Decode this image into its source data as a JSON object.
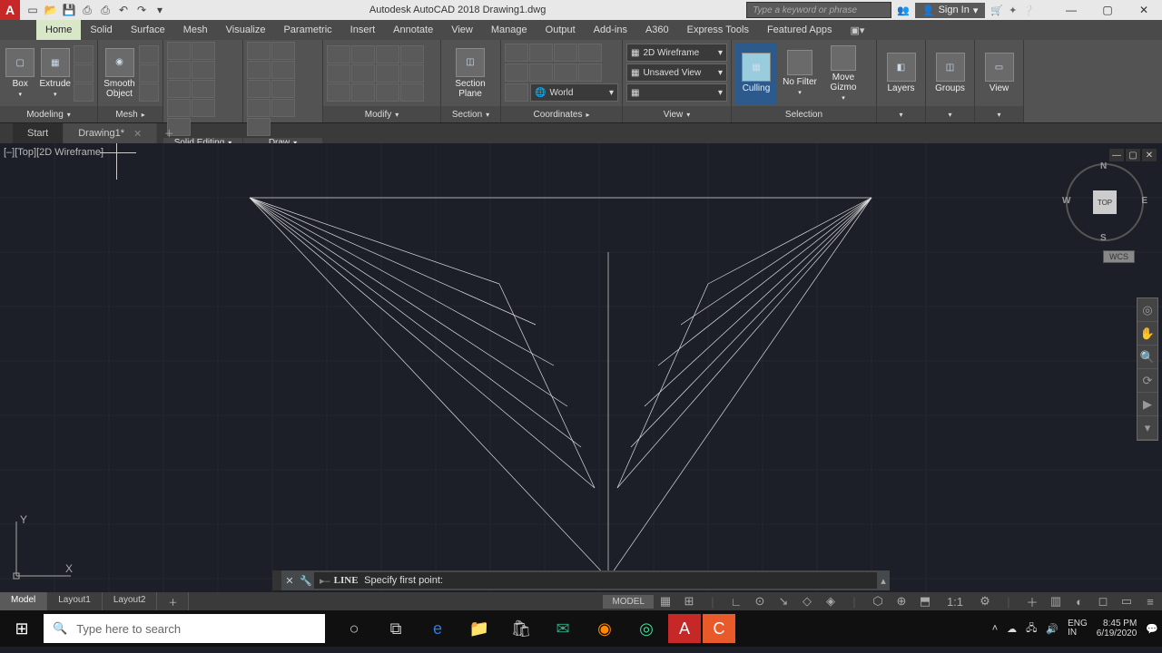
{
  "app": {
    "title": "Autodesk AutoCAD 2018   Drawing1.dwg",
    "search_placeholder": "Type a keyword or phrase",
    "signin": "Sign In"
  },
  "ribbon_tabs": [
    "Home",
    "Solid",
    "Surface",
    "Mesh",
    "Visualize",
    "Parametric",
    "Insert",
    "Annotate",
    "View",
    "Manage",
    "Output",
    "Add-ins",
    "A360",
    "Express Tools",
    "Featured Apps"
  ],
  "active_ribbon_tab": 0,
  "panels": {
    "modeling": {
      "title": "Modeling",
      "box": "Box",
      "extrude": "Extrude"
    },
    "mesh": {
      "title": "Mesh",
      "smooth": "Smooth\nObject"
    },
    "solid_editing": {
      "title": "Solid Editing"
    },
    "draw": {
      "title": "Draw"
    },
    "modify": {
      "title": "Modify"
    },
    "section": {
      "title": "Section",
      "plane": "Section\nPlane"
    },
    "coordinates": {
      "title": "Coordinates",
      "world": "World"
    },
    "view": {
      "title": "View",
      "visual_style": "2D Wireframe",
      "view_state": "Unsaved View"
    },
    "selection": {
      "title": "Selection",
      "culling": "Culling",
      "nofilter": "No Filter",
      "gizmo": "Move\nGizmo"
    },
    "layers": {
      "title": "Layers"
    },
    "groups": {
      "title": "Groups"
    },
    "view_panel": {
      "title": "View"
    }
  },
  "file_tabs": {
    "start": "Start",
    "drawing": "Drawing1*"
  },
  "viewport": {
    "label": "[–][Top][2D Wireframe]",
    "cube": {
      "n": "N",
      "s": "S",
      "e": "E",
      "w": "W",
      "face": "TOP"
    },
    "wcs": "WCS",
    "ucs_y": "Y",
    "ucs_x": "X"
  },
  "command": {
    "prompt": "LINE Specify first point:",
    "prefix": "▸–"
  },
  "layout_tabs": [
    "Model",
    "Layout1",
    "Layout2"
  ],
  "status": {
    "model": "MODEL",
    "scale": "1:1"
  },
  "taskbar": {
    "search_placeholder": "Type here to search",
    "lang1": "ENG",
    "lang2": "IN",
    "time": "8:45 PM",
    "date": "6/19/2020"
  }
}
